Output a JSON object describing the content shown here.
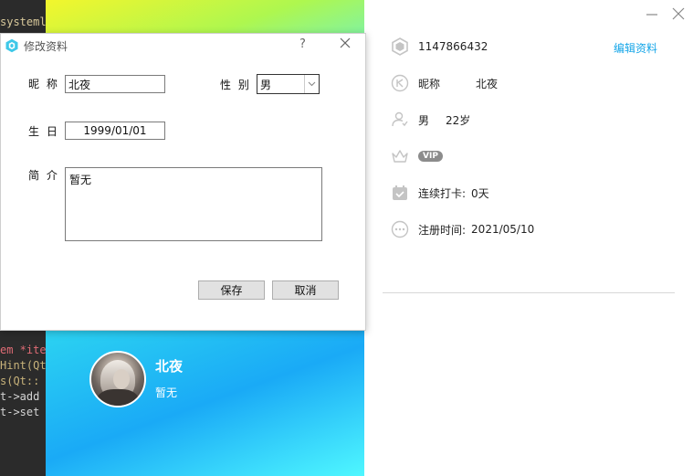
{
  "editor": {
    "lines": [
      "systeml",
      "em *ite",
      "Hint(Qt",
      "s(Qt::",
      "t->add",
      "t->set"
    ]
  },
  "profile_card": {
    "name": "北夜",
    "bio": "暂无"
  },
  "info_panel": {
    "account_id": "1147866432",
    "edit_link": "编辑资料",
    "nickname_label": "昵称",
    "nickname_value": "北夜",
    "gender": "男",
    "age": "22岁",
    "vip_badge": "VIP",
    "checkin_label": "连续打卡:",
    "checkin_value": "0天",
    "register_label": "注册时间:",
    "register_value": "2021/05/10"
  },
  "dialog": {
    "title": "修改资料",
    "help": "?",
    "nickname_label": "昵  称",
    "nickname_value": "北夜",
    "gender_label": "性  别",
    "gender_value": "男",
    "birthday_label": "生  日",
    "birthday_value": "1999/01/01",
    "intro_label": "简  介",
    "intro_value": "暂无",
    "save_button": "保存",
    "cancel_button": "取消"
  },
  "colors": {
    "accent": "#16a6e8",
    "icon_gray": "#c4c4c4"
  }
}
